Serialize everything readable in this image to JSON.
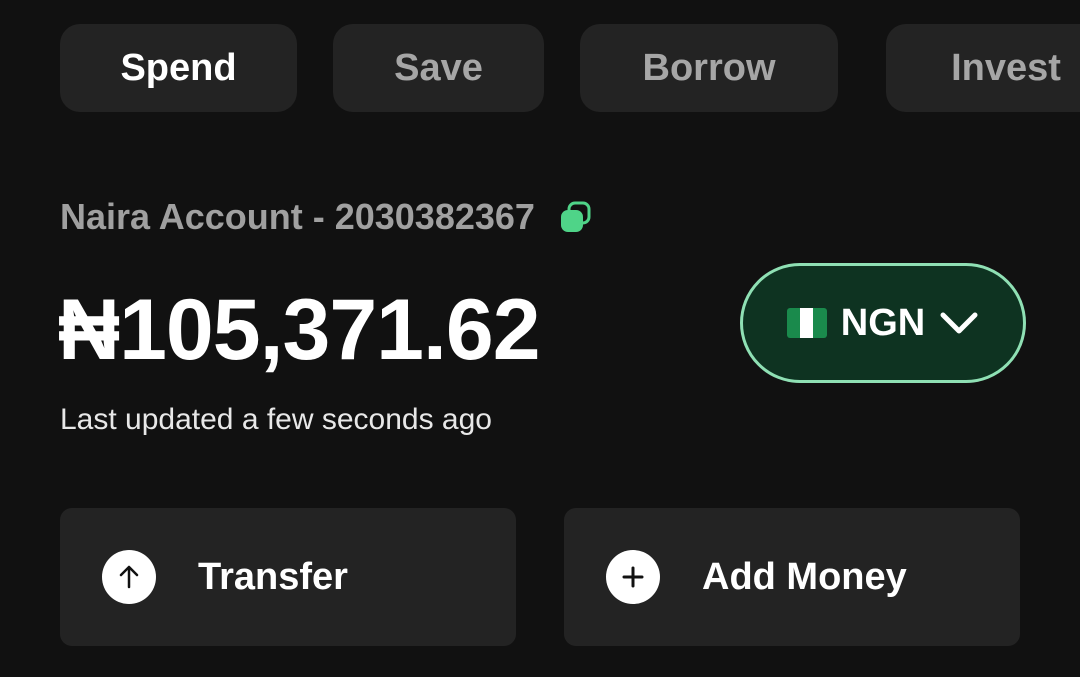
{
  "tabs": [
    {
      "label": "Spend",
      "active": true
    },
    {
      "label": "Save",
      "active": false
    },
    {
      "label": "Borrow",
      "active": false
    },
    {
      "label": "Invest",
      "active": false
    }
  ],
  "account": {
    "label": "Naira Account - 2030382367",
    "copy_icon": "copy-icon"
  },
  "balance": {
    "amount": "₦105,371.62",
    "updated": "Last updated a few seconds ago"
  },
  "currency": {
    "flag_icon": "nigeria-flag-icon",
    "code": "NGN",
    "dropdown_icon": "chevron-down-icon"
  },
  "actions": [
    {
      "label": "Transfer",
      "icon": "arrow-up-icon"
    },
    {
      "label": "Add Money",
      "icon": "plus-icon"
    }
  ],
  "colors": {
    "background": "#111111",
    "card": "#232323",
    "accent": "#4fd488",
    "currency_bg": "#0e3321",
    "currency_border": "#8fe0b4",
    "muted_text": "#a0a0a0"
  }
}
